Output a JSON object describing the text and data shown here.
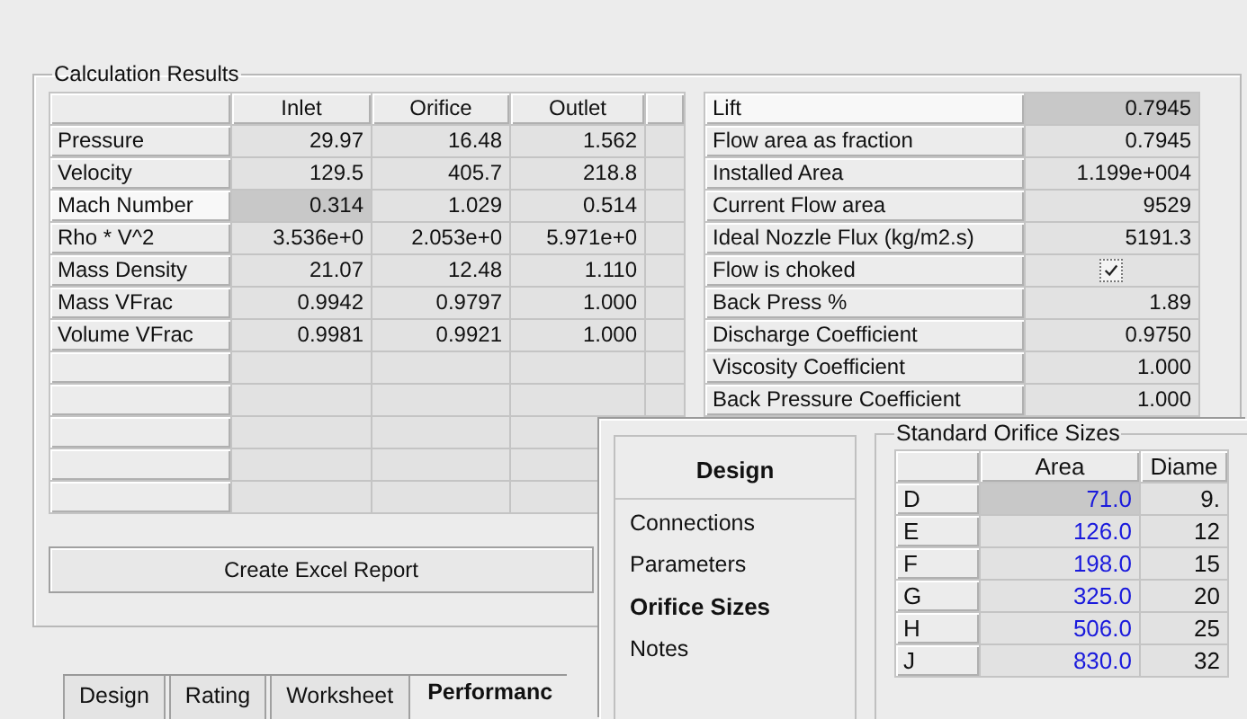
{
  "calculation_results": {
    "title": "Calculation Results",
    "columns": [
      "Inlet",
      "Orifice",
      "Outlet"
    ],
    "rows": [
      {
        "label": "Pressure",
        "values": [
          "29.97",
          "16.48",
          "1.562"
        ],
        "selected": false
      },
      {
        "label": "Velocity",
        "values": [
          "129.5",
          "405.7",
          "218.8"
        ],
        "selected": false
      },
      {
        "label": "Mach Number",
        "values": [
          "0.314",
          "1.029",
          "0.514"
        ],
        "selected": true
      },
      {
        "label": "Rho * V^2",
        "values": [
          "3.536e+0",
          "2.053e+0",
          "5.971e+0"
        ],
        "selected": false
      },
      {
        "label": "Mass Density",
        "values": [
          "21.07",
          "12.48",
          "1.110"
        ],
        "selected": false
      },
      {
        "label": "Mass VFrac",
        "values": [
          "0.9942",
          "0.9797",
          "1.000"
        ],
        "selected": false
      },
      {
        "label": "Volume VFrac",
        "values": [
          "0.9981",
          "0.9921",
          "1.000"
        ],
        "selected": false
      }
    ],
    "properties": [
      {
        "kind": "text",
        "label": "Lift",
        "value": "0.7945",
        "selected": true
      },
      {
        "kind": "text",
        "label": "Flow area as fraction",
        "value": "0.7945",
        "selected": false
      },
      {
        "kind": "text",
        "label": "Installed Area",
        "value": "1.199e+004",
        "selected": false
      },
      {
        "kind": "text",
        "label": "Current Flow area",
        "value": "9529",
        "selected": false
      },
      {
        "kind": "text",
        "label": "Ideal Nozzle Flux (kg/m2.s)",
        "value": "5191.3",
        "selected": false
      },
      {
        "kind": "checkbox",
        "label": "Flow is choked",
        "checked": true,
        "selected": false
      },
      {
        "kind": "text",
        "label": "Back Press %",
        "value": "1.89",
        "selected": false
      },
      {
        "kind": "text",
        "label": "Discharge Coefficient",
        "value": "0.9750",
        "selected": false
      },
      {
        "kind": "text",
        "label": "Viscosity Coefficient",
        "value": "1.000",
        "selected": false
      },
      {
        "kind": "text",
        "label": "Back Pressure Coefficient",
        "value": "1.000",
        "selected": false
      }
    ],
    "button": "Create Excel Report"
  },
  "tabs": [
    {
      "label": "Design",
      "selected": false
    },
    {
      "label": "Rating",
      "selected": false
    },
    {
      "label": "Worksheet",
      "selected": false
    },
    {
      "label": "Performanc",
      "selected": true
    }
  ],
  "design_window": {
    "nav_title": "Design",
    "nav_items": [
      {
        "label": "Connections",
        "selected": false
      },
      {
        "label": "Parameters",
        "selected": false
      },
      {
        "label": "Orifice Sizes",
        "selected": true
      },
      {
        "label": "Notes",
        "selected": false
      }
    ],
    "orifice_sizes": {
      "title": "Standard Orifice Sizes",
      "columns": [
        "Area",
        "Diame"
      ],
      "rows": [
        {
          "label": "D",
          "area": "71.0",
          "diameter": "9.",
          "selected": true
        },
        {
          "label": "E",
          "area": "126.0",
          "diameter": "12",
          "selected": false
        },
        {
          "label": "F",
          "area": "198.0",
          "diameter": "15",
          "selected": false
        },
        {
          "label": "G",
          "area": "325.0",
          "diameter": "20",
          "selected": false
        },
        {
          "label": "H",
          "area": "506.0",
          "diameter": "25",
          "selected": false
        },
        {
          "label": "J",
          "area": "830.0",
          "diameter": "32",
          "selected": false
        }
      ]
    }
  }
}
